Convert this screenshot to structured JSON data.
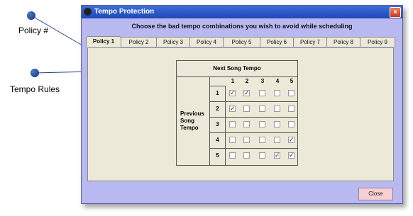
{
  "callouts": {
    "policy_label": "Policy #",
    "rules_label": "Tempo Rules"
  },
  "window": {
    "title": "Tempo Protection",
    "heading": "Choose the bad tempo combinations you wish to avoid while scheduling",
    "close_label": "Close"
  },
  "tabs": [
    "Policy 1",
    "Policy 2",
    "Policy 3",
    "Policy 4",
    "Policy 5",
    "Policy 6",
    "Policy 7",
    "Policy 8",
    "Policy 9"
  ],
  "active_tab": 0,
  "grid": {
    "next_label": "Next Song Tempo",
    "prev_label_lines": [
      "Previous",
      "Song",
      "Tempo"
    ],
    "columns": [
      "1",
      "2",
      "3",
      "4",
      "5"
    ],
    "rows": [
      {
        "label": "1",
        "checked": [
          true,
          true,
          false,
          false,
          false
        ]
      },
      {
        "label": "2",
        "checked": [
          true,
          false,
          false,
          false,
          false
        ]
      },
      {
        "label": "3",
        "checked": [
          false,
          false,
          false,
          false,
          false
        ]
      },
      {
        "label": "4",
        "checked": [
          false,
          false,
          false,
          false,
          true
        ]
      },
      {
        "label": "5",
        "checked": [
          false,
          false,
          false,
          true,
          true
        ]
      }
    ]
  },
  "colors": {
    "titlebar": "#2a56c6",
    "frame": "#b9b9f1",
    "panel": "#ece9d8",
    "close_button": "#f7cfd4"
  },
  "icons": {
    "callout": "bullet-dot-icon",
    "check": "check-mark-icon",
    "close": "close-x-icon"
  }
}
